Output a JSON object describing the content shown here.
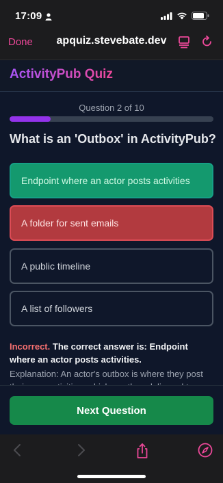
{
  "status": {
    "time": "17:09"
  },
  "browser": {
    "done_label": "Done",
    "url": "apquiz.stevebate.dev"
  },
  "app": {
    "title": "ActivityPub Quiz"
  },
  "quiz": {
    "progress_label": "Question 2 of 10",
    "progress_fraction": 0.2,
    "question": "What is an 'Outbox' in ActivityPub?",
    "answers": [
      {
        "text": "Endpoint where an actor posts activities",
        "state": "correct"
      },
      {
        "text": "A folder for sent emails",
        "state": "incorrect-selected"
      },
      {
        "text": "A public timeline",
        "state": "neutral"
      },
      {
        "text": "A list of followers",
        "state": "neutral"
      }
    ],
    "feedback": {
      "verdict": "Incorrect.",
      "message": "The correct answer is:",
      "correct_answer": "Endpoint where an actor posts activities."
    },
    "explanation": "Explanation: An actor's outbox is where they post their own activities, which are then delivered to",
    "next_label": "Next Question"
  },
  "colors": {
    "accent": "#ec4899",
    "title_gradient_start": "#a855f7",
    "progress": "#9333ea",
    "correct": "#14996e",
    "incorrect": "#b23a3f",
    "next_button": "#16894a"
  },
  "icons": [
    "person-icon",
    "signal-icon",
    "wifi-icon",
    "battery-icon",
    "reader-icon",
    "reload-icon",
    "back-icon",
    "forward-icon",
    "share-icon",
    "compass-icon"
  ]
}
